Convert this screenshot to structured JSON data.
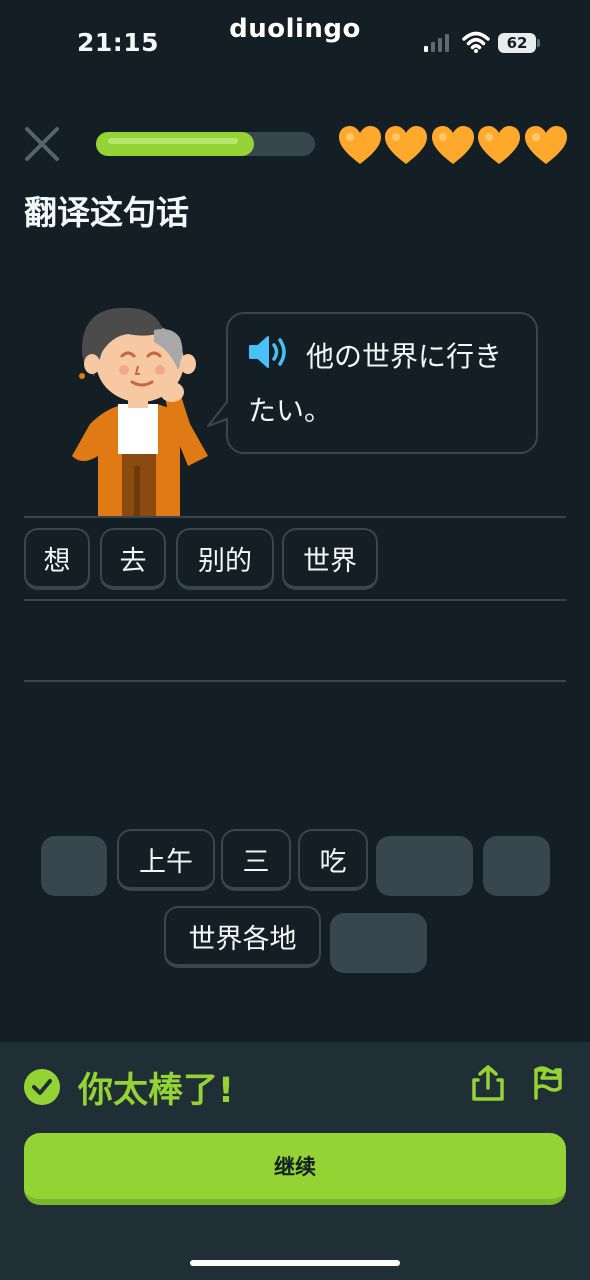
{
  "status_bar": {
    "time": "21:15",
    "app_name": "duolingo",
    "battery": "62",
    "signal_icon": "cellular-signal-icon",
    "wifi_icon": "wifi-icon"
  },
  "header": {
    "close_icon": "close-icon",
    "progress": 0.72,
    "hearts": 5,
    "heart_icon": "heart-icon"
  },
  "prompt": {
    "title": "翻译这句话",
    "speaker_icon": "speaker-icon",
    "sentence": "他の世界に行きたい。"
  },
  "answer_tiles": [
    "想",
    "去",
    "别的",
    "世界"
  ],
  "word_bank": {
    "row1": [
      "",
      "上午",
      "三",
      "吃",
      "",
      ""
    ],
    "row2": [
      "世界各地",
      ""
    ]
  },
  "feedback": {
    "check_icon": "check-circle-icon",
    "message": "你太棒了!",
    "share_icon": "share-icon",
    "flag_icon": "flag-icon"
  },
  "continue_label": "继续",
  "colors": {
    "background": "#131f24",
    "accent_green": "#93d333",
    "heart": "#ffa92c",
    "tile_border": "#37464f",
    "footer": "#202f36",
    "speaker": "#49c0f8"
  }
}
